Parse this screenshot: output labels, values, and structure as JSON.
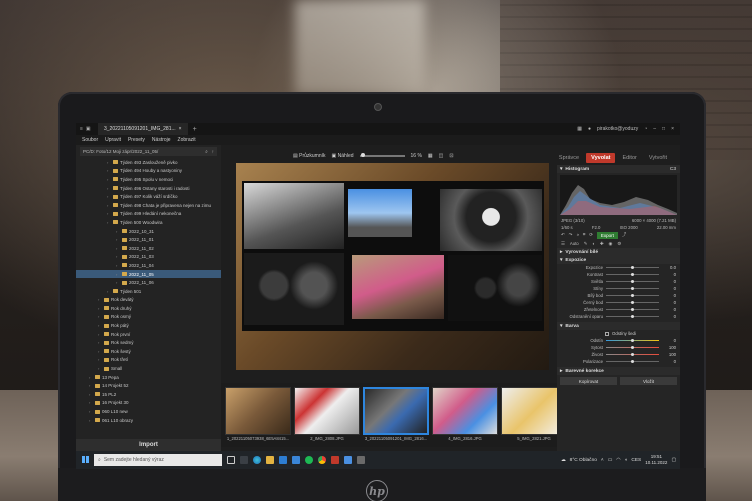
{
  "window": {
    "tab_title": "3_20221105091201_IMG_281...",
    "user": "pirakotko@yoduzy"
  },
  "menu": [
    "Soubor",
    "Upravit",
    "Presety",
    "Nástroje",
    "Zobrazit"
  ],
  "modules": [
    {
      "label": "Správce",
      "active": false
    },
    {
      "label": "Vyvolat",
      "active": true
    },
    {
      "label": "Editor",
      "active": false
    },
    {
      "label": "Vytvořit",
      "active": false
    }
  ],
  "path_bar": "PC/D: Foto/12 Moji zápr/2022_11_05/",
  "tree": [
    {
      "label": "Týden 493 Zaslouženě pivko",
      "indent": 3,
      "sel": false
    },
    {
      "label": "Týden 494 Houby a nastyoniny",
      "indent": 3,
      "sel": false
    },
    {
      "label": "Týden 495 Spolu v nemoci",
      "indent": 3,
      "sel": false
    },
    {
      "label": "Týden 496 Ostany starosti i radosti",
      "indent": 3,
      "sel": false
    },
    {
      "label": "Týden 497 Kolik váží srdíčko",
      "indent": 3,
      "sel": false
    },
    {
      "label": "Týden 498 Chata je připravena nejen na zimu",
      "indent": 3,
      "sel": false
    },
    {
      "label": "Týden 499 Hledání nekonečna",
      "indent": 3,
      "sel": false
    },
    {
      "label": "Týden 500 Woodwira",
      "indent": 3,
      "sel": false
    },
    {
      "label": "2022_10_31",
      "indent": 4,
      "sel": false
    },
    {
      "label": "2022_11_01",
      "indent": 4,
      "sel": false
    },
    {
      "label": "2022_11_02",
      "indent": 4,
      "sel": false
    },
    {
      "label": "2022_11_03",
      "indent": 4,
      "sel": false
    },
    {
      "label": "2022_11_04",
      "indent": 4,
      "sel": false
    },
    {
      "label": "2022_11_05",
      "indent": 4,
      "sel": true
    },
    {
      "label": "2022_11_06",
      "indent": 4,
      "sel": false
    },
    {
      "label": "Týden 501",
      "indent": 3,
      "sel": false
    },
    {
      "label": "Rok devátý",
      "indent": 2,
      "sel": false
    },
    {
      "label": "Rok druhý",
      "indent": 2,
      "sel": false
    },
    {
      "label": "Rok osmý",
      "indent": 2,
      "sel": false
    },
    {
      "label": "Rok pátý",
      "indent": 2,
      "sel": false
    },
    {
      "label": "Rok první",
      "indent": 2,
      "sel": false
    },
    {
      "label": "Rok sedmý",
      "indent": 2,
      "sel": false
    },
    {
      "label": "Rok šestý",
      "indent": 2,
      "sel": false
    },
    {
      "label": "Rok třetí",
      "indent": 2,
      "sel": false
    },
    {
      "label": "Small",
      "indent": 2,
      "sel": false
    },
    {
      "label": "13 Pepa",
      "indent": 1,
      "sel": false
    },
    {
      "label": "14 Projekt 52",
      "indent": 1,
      "sel": false
    },
    {
      "label": "15 PL2",
      "indent": 1,
      "sel": false
    },
    {
      "label": "16 Projekt 30",
      "indent": 1,
      "sel": false
    },
    {
      "label": "060 L10 new",
      "indent": 1,
      "sel": false
    },
    {
      "label": "061 L10 obrazy",
      "indent": 1,
      "sel": false
    }
  ],
  "import_label": "Import",
  "toolbar": {
    "browse": "Průzkumník",
    "preview": "Náhled",
    "zoom": "16 %"
  },
  "filmstrip": [
    {
      "label": "1_20221105073938_6E5A8415...",
      "sel": false
    },
    {
      "label": "2_IMG_2808.JPG",
      "sel": false
    },
    {
      "label": "3_20221105091201_IMG_2816...",
      "sel": true
    },
    {
      "label": "4_IMG_2816.JPG",
      "sel": false
    },
    {
      "label": "5_IMG_2821.JPG",
      "sel": false
    }
  ],
  "right": {
    "histogram_title": "Histogram",
    "histogram_count": "C3",
    "file_info": "JPEG (3/10)",
    "dims": "6000 × 4000 (7.21 MB)",
    "shutter": "1/60 s",
    "aperture": "F2.0",
    "iso": "ISO 2000",
    "focal": "22.00 mm",
    "export_label": "Export",
    "auto_label": "Auto",
    "section_wb": "Vyrovnání bílé",
    "section_exposure": "Expozice",
    "exposure_rows": [
      {
        "label": "Expozice",
        "value": "0.0"
      },
      {
        "label": "Kontrast",
        "value": "0"
      },
      {
        "label": "Světla",
        "value": "0"
      },
      {
        "label": "Stíny",
        "value": "0"
      },
      {
        "label": "Bílý bod",
        "value": "0"
      },
      {
        "label": "Černý bod",
        "value": "0"
      },
      {
        "label": "Zřetelnost",
        "value": "0"
      },
      {
        "label": "Odstranění oparu",
        "value": "0"
      }
    ],
    "section_color": "Barva",
    "color_check": "Odstíny šedi",
    "color_rows": [
      {
        "label": "Odstín",
        "value": "0"
      },
      {
        "label": "Sytost",
        "value": "100"
      },
      {
        "label": "Živost",
        "value": "100"
      },
      {
        "label": "Polarizace",
        "value": "0"
      }
    ],
    "section_color_correction": "Barevné korekce",
    "copy_label": "Kopírovat",
    "paste_label": "Vložit"
  },
  "taskbar": {
    "search_placeholder": "Sem zadejte hledaný výraz",
    "weather": "8°C Oblačno",
    "lang": "CES",
    "time": "19:51",
    "date": "10.11.2022"
  }
}
